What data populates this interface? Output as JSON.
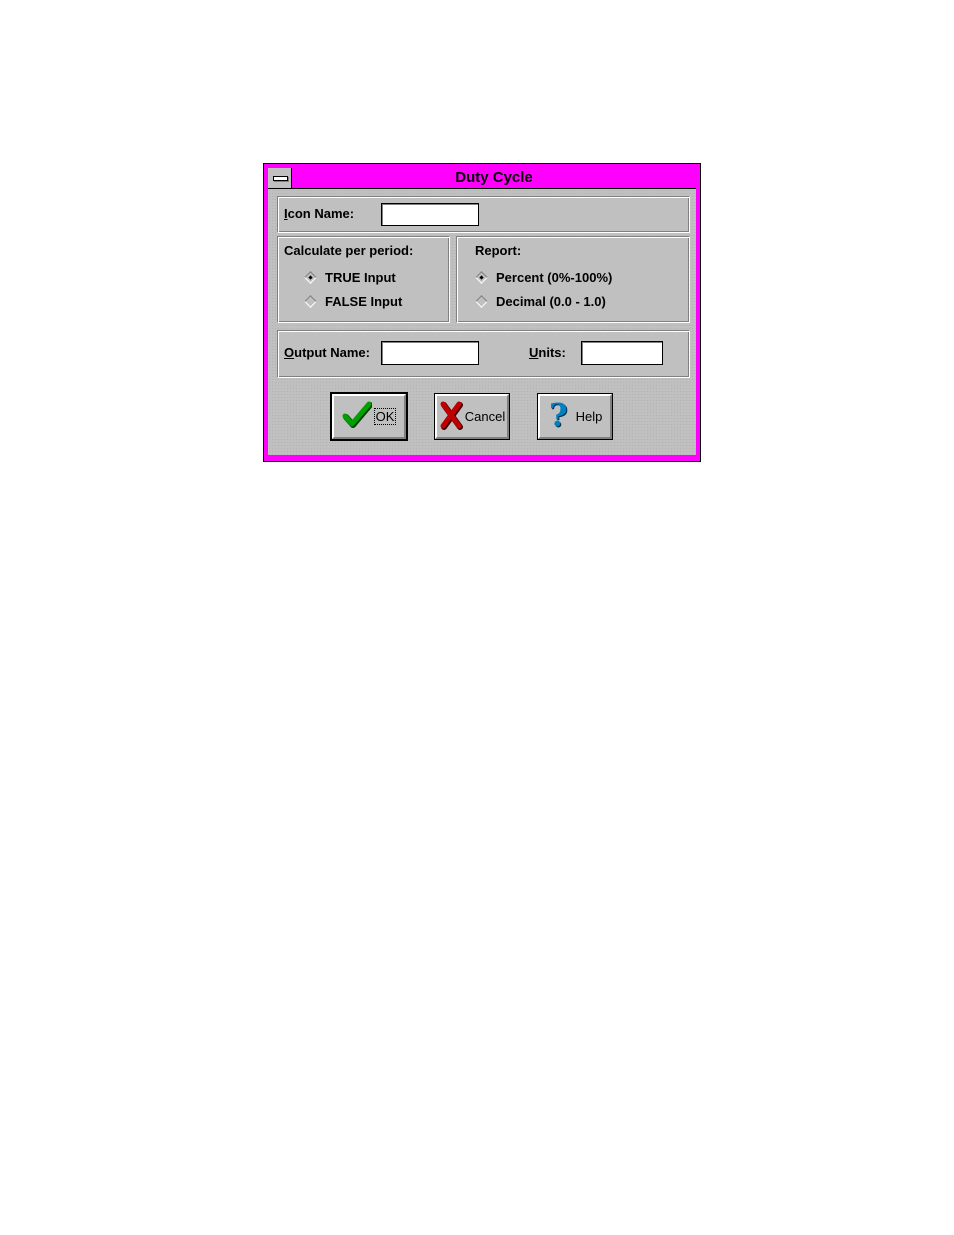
{
  "window": {
    "title": "Duty Cycle"
  },
  "icon_name": {
    "label_mnemonic": "I",
    "label_rest": "con Name:",
    "value": ""
  },
  "calculate": {
    "heading": "Calculate per period:",
    "options": [
      {
        "label": "TRUE Input",
        "selected": true
      },
      {
        "label": "FALSE Input",
        "selected": false
      }
    ]
  },
  "report": {
    "heading": "Report:",
    "options": [
      {
        "label": "Percent (0%-100%)",
        "selected": true
      },
      {
        "label": "Decimal (0.0 - 1.0)",
        "selected": false
      }
    ]
  },
  "output_name": {
    "label_mnemonic": "O",
    "label_rest": "utput Name:",
    "value": ""
  },
  "units": {
    "label_mnemonic": "U",
    "label_rest": "nits:",
    "value": ""
  },
  "buttons": {
    "ok": {
      "label": "OK",
      "icon": "checkmark-icon",
      "color": "#00a000"
    },
    "cancel": {
      "label": "Cancel",
      "icon": "x-icon",
      "color": "#c00000"
    },
    "help": {
      "label": "Help",
      "icon": "question-mark-icon",
      "color": "#0080c0"
    }
  },
  "colors": {
    "title_bar": "#ff00ff",
    "face": "#c0c0c0"
  }
}
